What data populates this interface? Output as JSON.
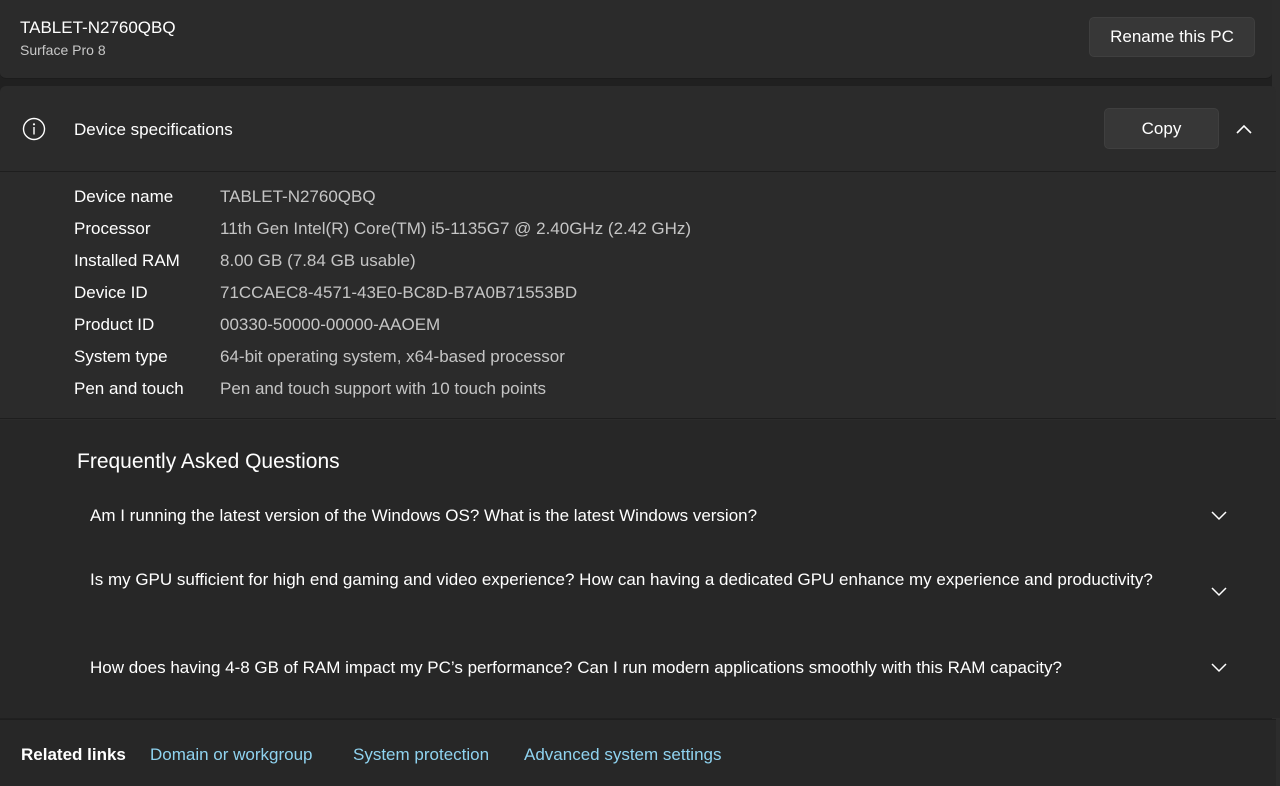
{
  "device": {
    "name": "TABLET-N2760QBQ",
    "model": "Surface Pro 8",
    "rename_label": "Rename this PC"
  },
  "specs": {
    "title": "Device specifications",
    "copy_label": "Copy",
    "rows": [
      {
        "label": "Device name",
        "value": "TABLET-N2760QBQ"
      },
      {
        "label": "Processor",
        "value": "11th Gen Intel(R) Core(TM) i5-1135G7 @ 2.40GHz (2.42 GHz)"
      },
      {
        "label": "Installed RAM",
        "value": "8.00 GB (7.84 GB usable)"
      },
      {
        "label": "Device ID",
        "value": "71CCAEC8-4571-43E0-BC8D-B7A0B71553BD"
      },
      {
        "label": "Product ID",
        "value": "00330-50000-00000-AAOEM"
      },
      {
        "label": "System type",
        "value": "64-bit operating system, x64-based processor"
      },
      {
        "label": "Pen and touch",
        "value": "Pen and touch support with 10 touch points"
      }
    ]
  },
  "faq": {
    "title": "Frequently Asked Questions",
    "items": [
      "Am I running the latest version of the Windows OS? What is the latest Windows version?",
      "Is my GPU sufficient for high end gaming and video experience? How can having a dedicated GPU enhance my experience and productivity?",
      "How does having 4-8 GB of RAM impact my PC’s performance? Can I run modern applications smoothly with this RAM capacity?"
    ]
  },
  "related": {
    "title": "Related links",
    "links": [
      "Domain or workgroup",
      "System protection",
      "Advanced system settings"
    ]
  },
  "icons": {
    "info": "info-icon",
    "collapse": "chevron-up-icon",
    "expand": "chevron-down-icon"
  },
  "colors": {
    "background": "#202020",
    "card": "#2b2b2b",
    "link": "#8fd3f0"
  }
}
